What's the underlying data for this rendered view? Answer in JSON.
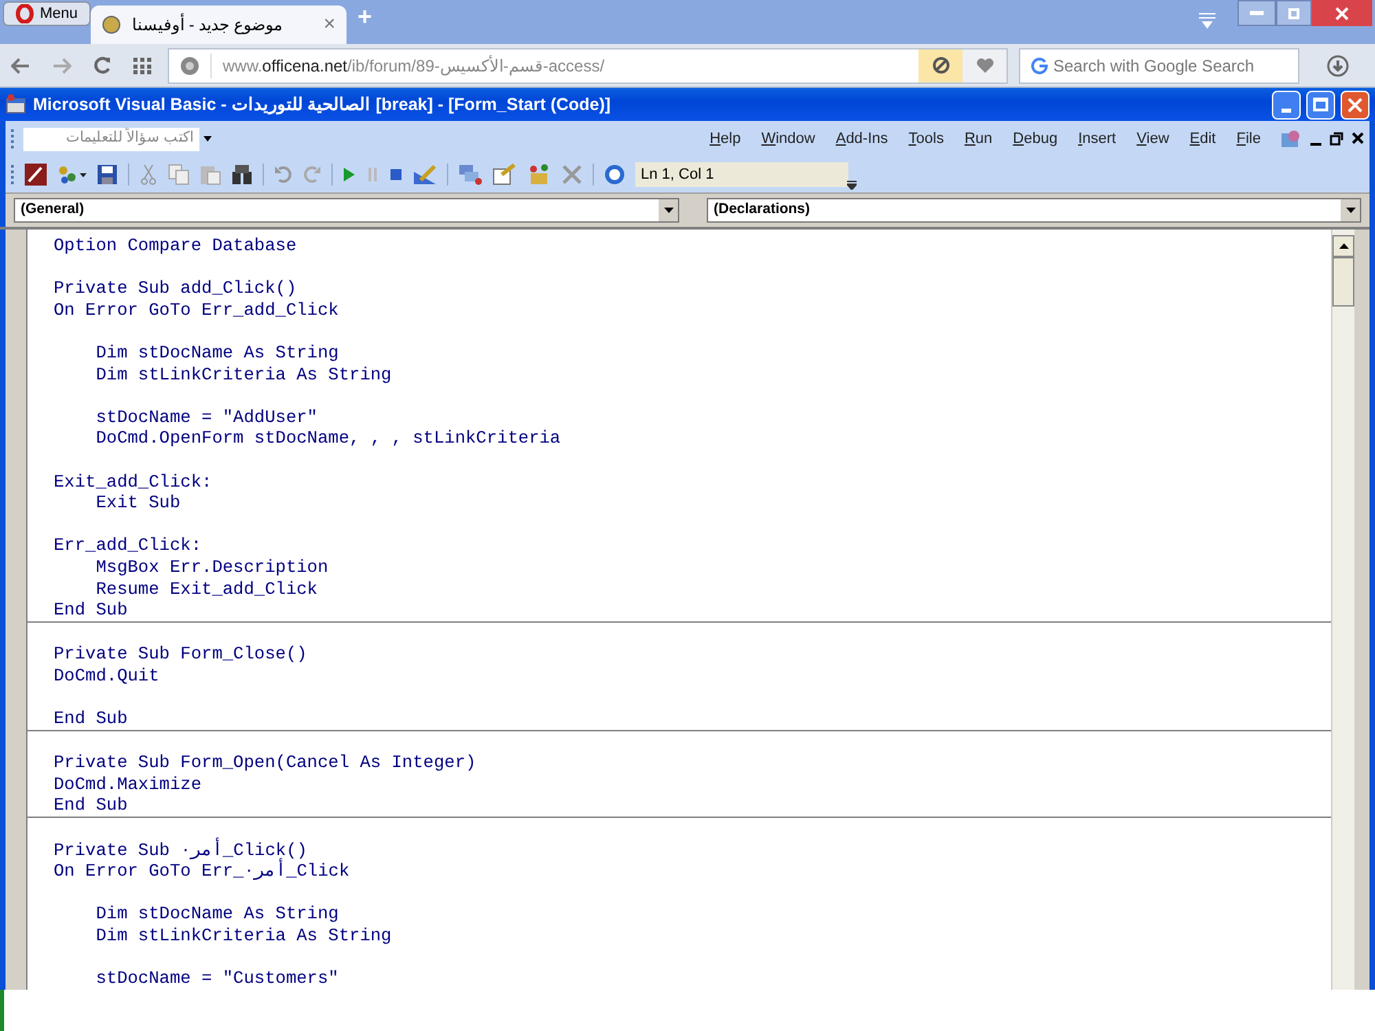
{
  "browser": {
    "menu_button": "Menu",
    "tab": {
      "title": "موضوع جديد - أوفيسنا",
      "close": "×",
      "selected": true
    },
    "new_tab": "+",
    "address": {
      "prefix": "www.",
      "domain": "officena.net",
      "path": "/ib/forum/89-قسم-الأكسيس-access/"
    },
    "search": {
      "placeholder": "Search with Google Search"
    }
  },
  "window": {
    "title": "Microsoft Visual Basic - الصالحية للتوريدات [break] - [Form_Start (Code)]"
  },
  "help_box": {
    "placeholder": "اكتب سؤالاً للتعليمات"
  },
  "menus": [
    "Help",
    "Window",
    "Add-Ins",
    "Tools",
    "Run",
    "Debug",
    "Insert",
    "View",
    "Edit",
    "File"
  ],
  "position": "Ln 1, Col 1",
  "object_combo": "(General)",
  "procedure_combo": "(Declarations)",
  "procedures": [
    {
      "groups": [
        [
          "Option Compare Database"
        ],
        [
          "Private Sub add_Click()",
          "On Error GoTo Err_add_Click"
        ],
        [
          "    Dim stDocName As String",
          "    Dim stLinkCriteria As String"
        ],
        [
          "    stDocName = \"AddUser\"",
          "    DoCmd.OpenForm stDocName, , , stLinkCriteria"
        ],
        [
          "Exit_add_Click:",
          "    Exit Sub"
        ],
        [
          "Err_add_Click:",
          "    MsgBox Err.Description",
          "    Resume Exit_add_Click",
          "End Sub"
        ]
      ]
    },
    {
      "groups": [
        [
          "Private Sub Form_Close()",
          "DoCmd.Quit"
        ],
        [
          "End Sub"
        ]
      ]
    },
    {
      "groups": [
        [
          "Private Sub Form_Open(Cancel As Integer)",
          "DoCmd.Maximize",
          "End Sub"
        ]
      ]
    },
    {
      "groups": [
        [
          "Private Sub أمر٠_Click()",
          "On Error GoTo Err_أمر٠_Click"
        ],
        [
          "    Dim stDocName As String",
          "    Dim stLinkCriteria As String"
        ],
        [
          "    stDocName = \"Customers\""
        ]
      ]
    }
  ]
}
